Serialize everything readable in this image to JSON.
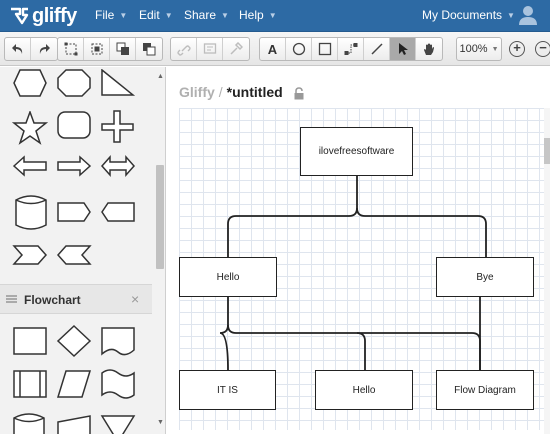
{
  "app": {
    "name": "gliffy"
  },
  "menubar": {
    "items": [
      {
        "label": "File"
      },
      {
        "label": "Edit"
      },
      {
        "label": "Share"
      },
      {
        "label": "Help"
      }
    ],
    "my_documents": "My Documents"
  },
  "toolbar": {
    "zoom": "100%",
    "text_tool": "A"
  },
  "panel": {
    "section_title": "Flowchart",
    "close_label": "×"
  },
  "document": {
    "app_label": "Gliffy",
    "separator": "/",
    "title": "*untitled"
  },
  "diagram": {
    "nodes": [
      {
        "label": "ilovefreesoftware"
      },
      {
        "label": "Hello"
      },
      {
        "label": "Bye"
      },
      {
        "label": "IT IS"
      },
      {
        "label": "Hello"
      },
      {
        "label": "Flow Diagram"
      }
    ]
  },
  "colors": {
    "brand": "#2d6aa4",
    "panel_bg": "#f2f2f2",
    "grid_line": "#dfe5ee"
  },
  "icons": [
    "gliffy-logo-icon",
    "undo-icon",
    "redo-icon",
    "select-icon",
    "group-icon",
    "bring-front-icon",
    "send-back-icon",
    "link-icon",
    "note-icon",
    "format-painter-icon",
    "text-icon",
    "ellipse-icon",
    "rectangle-icon",
    "connector-icon",
    "line-icon",
    "pointer-icon",
    "hand-icon",
    "zoom-in-icon",
    "zoom-out-icon",
    "user-icon",
    "lock-icon"
  ]
}
